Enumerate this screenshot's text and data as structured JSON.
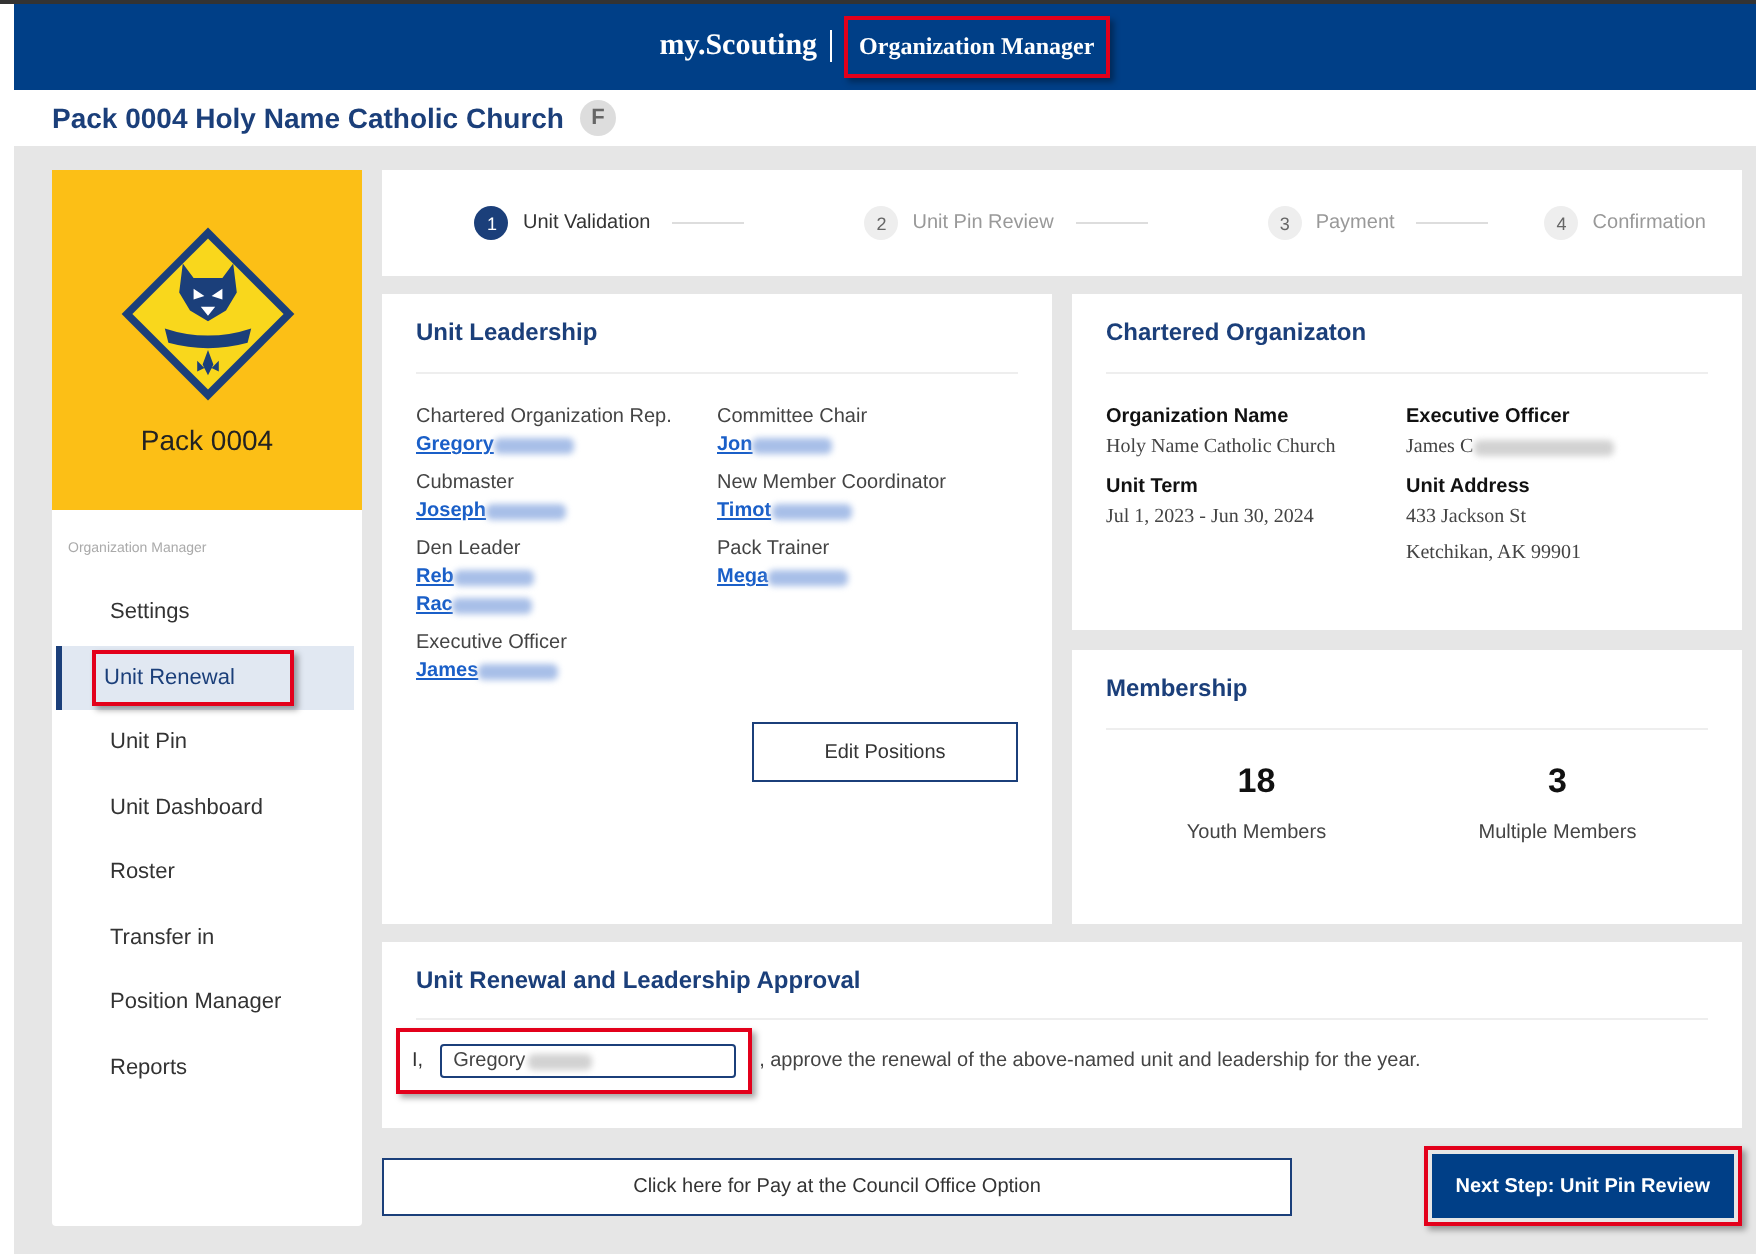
{
  "header": {
    "brand": "my.Scouting",
    "product": {
      "label": "Organization Manager",
      "highlighted": true
    }
  },
  "page_title": "Pack 0004 Holy Name Catholic Church",
  "page_badge": "F",
  "sidebar": {
    "unit_name": "Pack 0004",
    "section_label": "Organization Manager",
    "items": [
      {
        "label": "Settings",
        "selected": false,
        "highlighted": false
      },
      {
        "label": "Unit Renewal",
        "selected": true,
        "highlighted": true
      },
      {
        "label": "Unit Pin",
        "selected": false,
        "highlighted": false
      },
      {
        "label": "Unit Dashboard",
        "selected": false,
        "highlighted": false
      },
      {
        "label": "Roster",
        "selected": false,
        "highlighted": false
      },
      {
        "label": "Transfer in",
        "selected": false,
        "highlighted": false
      },
      {
        "label": "Position Manager",
        "selected": false,
        "highlighted": false
      },
      {
        "label": "Reports",
        "selected": false,
        "highlighted": false
      }
    ]
  },
  "steps": [
    {
      "number": "1",
      "label": "Unit Validation",
      "selected": true
    },
    {
      "number": "2",
      "label": "Unit Pin Review",
      "selected": false
    },
    {
      "number": "3",
      "label": "Payment",
      "selected": false
    },
    {
      "number": "4",
      "label": "Confirmation",
      "selected": false
    }
  ],
  "unit_leadership": {
    "title": "Unit Leadership",
    "columns": [
      [
        {
          "role": "Chartered Organization Rep.",
          "names": [
            {
              "text": "Gregory",
              "redacted": true
            }
          ]
        },
        {
          "role": "Cubmaster",
          "names": [
            {
              "text": "Joseph",
              "redacted": true
            }
          ]
        },
        {
          "role": "Den Leader",
          "names": [
            {
              "text": "Reb",
              "redacted": true
            },
            {
              "text": "Rac",
              "redacted": true
            }
          ]
        },
        {
          "role": "Executive Officer",
          "names": [
            {
              "text": "James",
              "redacted": true
            }
          ]
        }
      ],
      [
        {
          "role": "Committee Chair",
          "names": [
            {
              "text": "Jon",
              "redacted": true
            }
          ]
        },
        {
          "role": "New Member Coordinator",
          "names": [
            {
              "text": "Timot",
              "redacted": true
            }
          ]
        },
        {
          "role": "Pack Trainer",
          "names": [
            {
              "text": "Mega",
              "redacted": true
            }
          ]
        }
      ]
    ],
    "button": "Edit Positions"
  },
  "chartered_organization": {
    "title": "Chartered Organizaton",
    "fields": [
      {
        "label": "Organization Name",
        "lines": [
          "Holy Name Catholic Church"
        ],
        "redacted": false
      },
      {
        "label": "Executive Officer",
        "lines": [
          "James C"
        ],
        "redacted": true
      },
      {
        "label": "Unit Term",
        "lines": [
          "Jul 1, 2023 - Jun 30, 2024"
        ],
        "redacted": false
      },
      {
        "label": "Unit Address",
        "lines": [
          "433 Jackson St",
          "Ketchikan, AK 99901"
        ],
        "redacted": false
      }
    ]
  },
  "membership": {
    "title": "Membership",
    "stats": [
      {
        "value": "18",
        "label": "Youth Members"
      },
      {
        "value": "3",
        "label": "Multiple Members"
      }
    ]
  },
  "approval": {
    "title": "Unit Renewal and Leadership Approval",
    "prefix": "I,",
    "name_field": {
      "value": "Gregory",
      "redacted": true,
      "highlighted": true
    },
    "suffix": ", approve the renewal of the above-named unit and leadership for the year."
  },
  "pay_option_button": "Click here for Pay at the Council Office Option",
  "next_button": {
    "label": "Next Step: Unit Pin Review",
    "highlighted": true
  }
}
